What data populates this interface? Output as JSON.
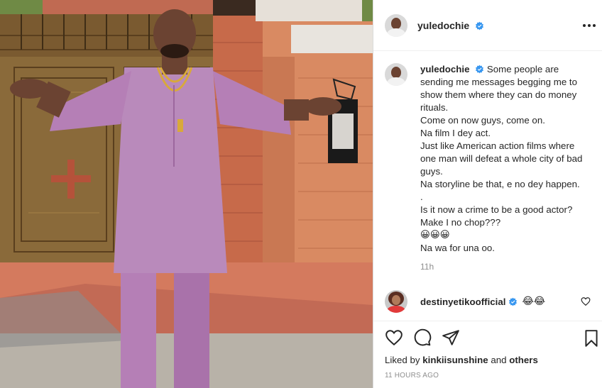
{
  "post": {
    "author": "yuledochie",
    "verified": true,
    "caption": {
      "author": "yuledochie",
      "lines": [
        "Some people are sending me messages begging me to show them where they can do money rituals.",
        "Come on now guys, come on.",
        "Na film I dey act.",
        "Just like American action films where one man will defeat a whole city of bad guys.",
        "Na storyline be that, e no dey happen.",
        ".",
        "Is it now a crime to be a good actor?",
        "Make I no chop???",
        "😀😀😀",
        "Na wa for una oo."
      ],
      "time": "11h"
    },
    "comments": [
      {
        "author": "destinyetikoofficial",
        "verified": true,
        "text": "😂😂"
      }
    ],
    "likes": {
      "prefix": "Liked by",
      "user": "kinkiisunshine",
      "joiner": "and",
      "others": "others"
    },
    "timestamp": "11 HOURS AGO"
  },
  "icons": {
    "more": "more-options-icon",
    "verified": "verified-badge-icon",
    "like": "heart-icon",
    "comment": "comment-icon",
    "share": "share-icon",
    "save": "bookmark-icon"
  },
  "colors": {
    "verified": "#3897f0",
    "text": "#262626",
    "muted": "#8e8e8e",
    "border": "#dbdbdb",
    "outfit": "#b57fb6"
  }
}
